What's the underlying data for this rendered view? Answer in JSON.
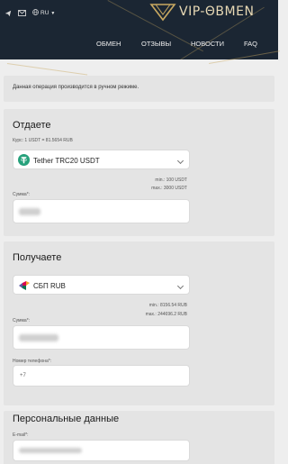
{
  "header": {
    "brand": "VIP-ΘBMEN",
    "lang": "RU",
    "nav": [
      "ОБМЕН",
      "ОТЗЫВЫ",
      "НОВОСТИ",
      "FAQ"
    ],
    "icons": [
      "telegram-icon",
      "mail-icon",
      "globe-icon",
      "chevron-down-icon"
    ]
  },
  "notice": {
    "text": "Данная операция производится в ручном режиме."
  },
  "give": {
    "title": "Отдаете",
    "rate": "Курс: 1 USDT = 81.5654 RUB",
    "currency": "Tether TRC20 USDT",
    "min": "min.: 100 USDT",
    "max": "max.: 3000 USDT",
    "amount_label": "Сумма*:"
  },
  "receive": {
    "title": "Получаете",
    "currency": "СБП RUB",
    "min": "min.: 8156.54 RUB",
    "max": "max.: 244696.2 RUB",
    "amount_label": "Сумма*:",
    "phone_label": "Номер телефона*:",
    "phone_placeholder": "+7"
  },
  "personal": {
    "title": "Персональные данные",
    "email_label": "E-mail*:"
  },
  "colors": {
    "header_bg": "#1b2633",
    "gold": "#c9a961",
    "tether": "#26a17b",
    "page_bg": "#eeeeee",
    "card_bg": "#e4e4e4"
  }
}
